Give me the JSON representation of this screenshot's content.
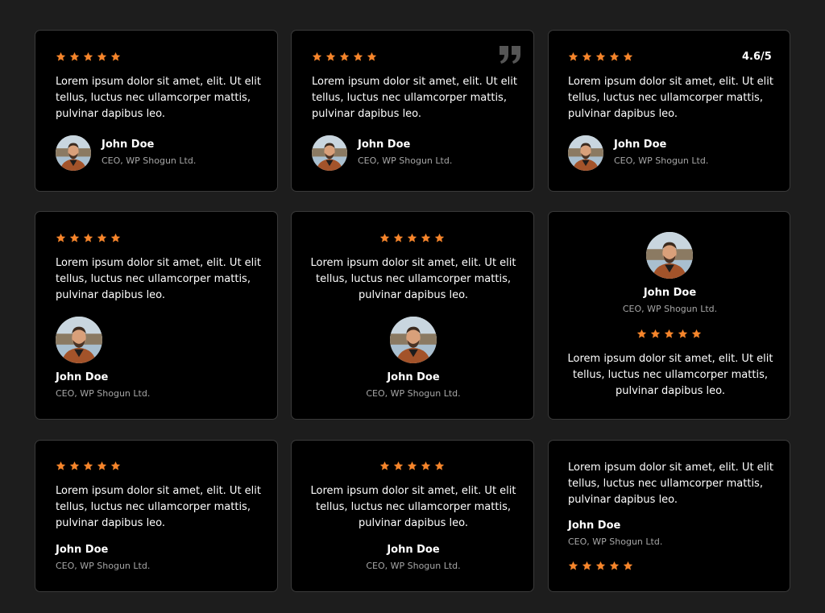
{
  "colors": {
    "star": "#f6852b",
    "background": "#1d1d1d",
    "card": "#000000",
    "role_text": "#a6a6a6"
  },
  "rating_label": "4.6/5",
  "cards": [
    {
      "text": "Lorem ipsum dolor sit amet, elit. Ut elit tellus, luctus nec ullamcorper mattis, pulvinar dapibus leo.",
      "name": "John Doe",
      "role": "CEO, WP Shogun Ltd.",
      "stars": 5
    },
    {
      "text": "Lorem ipsum dolor sit amet, elit. Ut elit tellus, luctus nec ullamcorper mattis, pulvinar dapibus leo.",
      "name": "John Doe",
      "role": "CEO, WP Shogun Ltd.",
      "stars": 5
    },
    {
      "text": "Lorem ipsum dolor sit amet, elit. Ut elit tellus, luctus nec ullamcorper mattis, pulvinar dapibus leo.",
      "name": "John Doe",
      "role": "CEO, WP Shogun Ltd.",
      "stars": 5
    },
    {
      "text": "Lorem ipsum dolor sit amet, elit. Ut elit tellus, luctus nec ullamcorper mattis, pulvinar dapibus leo.",
      "name": "John Doe",
      "role": "CEO, WP Shogun Ltd.",
      "stars": 5
    },
    {
      "text": "Lorem ipsum dolor sit amet, elit. Ut elit tellus, luctus nec ullamcorper mattis, pulvinar dapibus leo.",
      "name": "John Doe",
      "role": "CEO, WP Shogun Ltd.",
      "stars": 5
    },
    {
      "text": "Lorem ipsum dolor sit amet, elit. Ut elit tellus, luctus nec ullamcorper mattis, pulvinar dapibus leo.",
      "name": "John Doe",
      "role": "CEO, WP Shogun Ltd.",
      "stars": 5
    },
    {
      "text": "Lorem ipsum dolor sit amet, elit. Ut elit tellus, luctus nec ullamcorper mattis, pulvinar dapibus leo.",
      "name": "John Doe",
      "role": "CEO, WP Shogun Ltd.",
      "stars": 5
    },
    {
      "text": "Lorem ipsum dolor sit amet, elit. Ut elit tellus, luctus nec ullamcorper mattis, pulvinar dapibus leo.",
      "name": "John Doe",
      "role": "CEO, WP Shogun Ltd.",
      "stars": 5
    },
    {
      "text": "Lorem ipsum dolor sit amet, elit. Ut elit tellus, luctus nec ullamcorper mattis, pulvinar dapibus leo.",
      "name": "John Doe",
      "role": "CEO, WP Shogun Ltd.",
      "stars": 5
    }
  ]
}
